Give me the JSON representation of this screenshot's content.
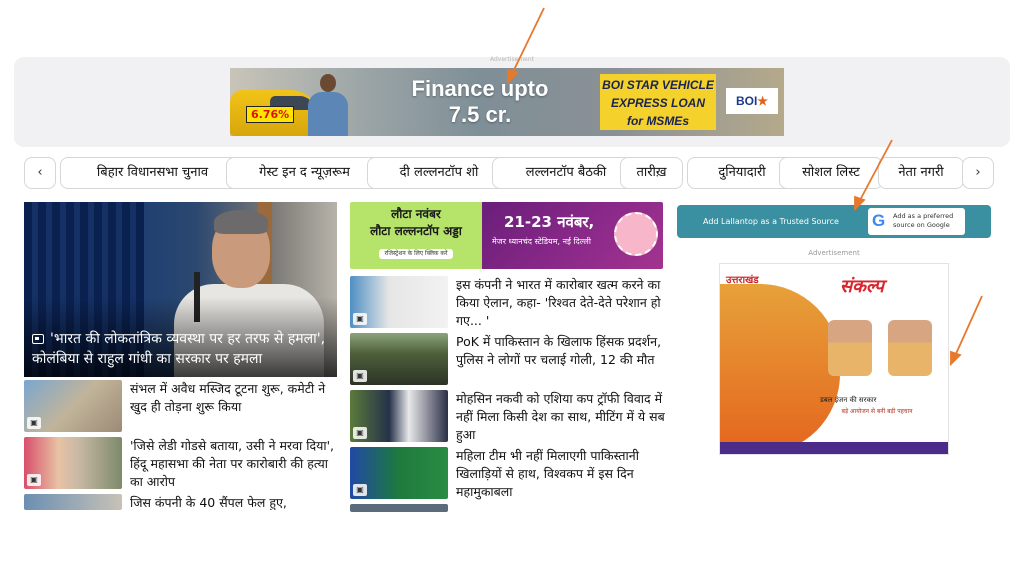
{
  "ads": {
    "top_label": "Advertisement",
    "banner": {
      "rate": "6.76%",
      "headline_line1": "Finance upto",
      "headline_line2": "7.5 cr.",
      "box_line1": "BOI STAR VEHICLE",
      "box_line2": "EXPRESS LOAN",
      "box_line3": "for MSMEs",
      "logo_text": "BOI",
      "logo_star": "★"
    },
    "right_label": "Advertisement",
    "side": {
      "title_left": "उत्तराखंड",
      "title_right": "संकल्प",
      "line1": "डबल इंजन की सरकार",
      "line2": "बड़े आयोजन से बनी बड़ी पहचान"
    }
  },
  "nav": {
    "prev_icon": "‹",
    "next_icon": "›",
    "items": [
      "बिहार विधानसभा चुनाव",
      "गेस्ट इन द न्यूज़रूम",
      "दी लल्लनटॉप शो",
      "लल्लनटॉप बैठकी",
      "तारीख़",
      "दुनियादारी",
      "सोशल लिस्ट",
      "नेता नगरी"
    ]
  },
  "left": {
    "hero_caption": "'भारत की लोकतांत्रिक व्यवस्था पर हर तरफ से हमला', कोलंबिया से राहुल गांधी का सरकार पर हमला",
    "stories": [
      "संभल में अवैध मस्जिद टूटना शुरू, कमेटी ने खुद ही तोड़ना शुरू किया",
      "'जिसे लेडी गोडसे बताया, उसी ने मरवा दिया', हिंदू महासभा की नेता पर कारोबारी की हत्या का आरोप",
      "जिस कंपनी के 40 सैंपल फेल हुए,"
    ]
  },
  "middle": {
    "promo": {
      "line1": "लौटा नवंबर",
      "line2": "लौटा लल्लनटॉप अड्डा",
      "register": "रजिस्ट्रेशन के लिए क्लिक करें",
      "date": "21-23 नवंबर,",
      "venue": "मेजर ध्यानचंद स्टेडियम, नई दिल्ली"
    },
    "stories": [
      "इस कंपनी ने भारत में कारोबार खत्म करने का किया ऐलान, कहा- 'रिश्वत देते-देते परेशान हो गए... '",
      "PoK में पाकिस्तान के खिलाफ हिंसक प्रदर्शन, पुलिस ने लोगों पर चलाई गोली, 12 की मौत",
      "मोहसिन नकवी को एशिया कप ट्रॉफी विवाद में नहीं मिला किसी देश का साथ, मीटिंग में ये सब हुआ",
      "महिला टीम भी नहीं मिलाएगी पाकिस्तानी खिलाड़ियों से हाथ, विश्वकप में इस दिन महामुकाबला"
    ]
  },
  "right": {
    "trusted_label": "Add Lallantop as a Trusted Source",
    "google_button": "Add as a preferred source on Google",
    "google_glyph": "G"
  },
  "colors": {
    "teal": "#3a8fa0",
    "annotation_arrow": "#e8782c"
  }
}
